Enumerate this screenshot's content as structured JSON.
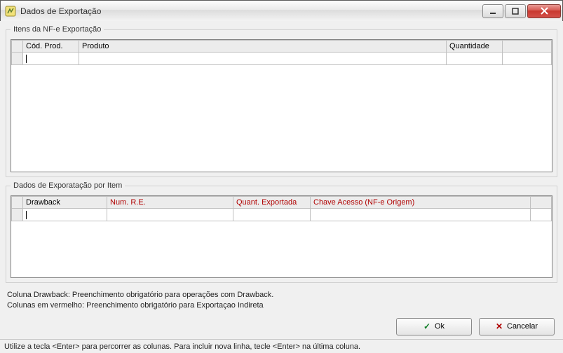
{
  "window": {
    "title": "Dados de Exportação"
  },
  "groups": {
    "itens": {
      "legend": "Itens da NF-e Exportação",
      "columns": {
        "cod_prod": "Cód. Prod.",
        "produto": "Produto",
        "quantidade": "Quantidade"
      }
    },
    "dados_item": {
      "legend": "Dados de Exporatação por Item",
      "columns": {
        "drawback": "Drawback",
        "num_re": "Num. R.E.",
        "quant_exportada": "Quant. Exportada",
        "chave_acesso": "Chave Acesso (NF-e Origem)"
      }
    }
  },
  "hints": {
    "line1": "Coluna Drawback: Preenchimento obrigatório para operações com Drawback.",
    "line2": "Colunas em vermelho: Preenchimento obrigatório para Exportaçao Indireta"
  },
  "buttons": {
    "ok": "Ok",
    "cancel": "Cancelar"
  },
  "statusbar": {
    "text": "Utilize a tecla <Enter>  para percorrer as colunas. Para incluir nova linha, tecle <Enter>  na última coluna."
  }
}
